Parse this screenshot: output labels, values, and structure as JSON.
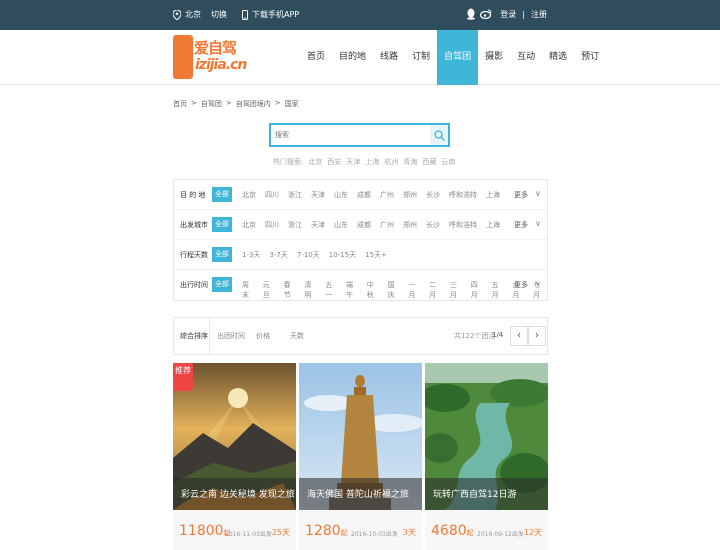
{
  "topbar": {
    "city": "北京",
    "switch": "切换",
    "app": "下载手机APP",
    "login": "登录",
    "sep": "|",
    "register": "注册"
  },
  "logo": {
    "cn": "爱自驾",
    "en": "izijia.cn"
  },
  "nav": [
    {
      "label": "首页",
      "active": false
    },
    {
      "label": "目的地",
      "active": false
    },
    {
      "label": "线路",
      "active": false
    },
    {
      "label": "订制",
      "active": false
    },
    {
      "label": "自驾团",
      "active": true
    },
    {
      "label": "摄影",
      "active": false
    },
    {
      "label": "互动",
      "active": false
    },
    {
      "label": "精选",
      "active": false
    },
    {
      "label": "预订",
      "active": false
    }
  ],
  "breadcrumb": [
    "首页",
    ">",
    "自驾团",
    ">",
    "自驾团境内",
    ">",
    "国家"
  ],
  "search": {
    "placeholder": "搜索"
  },
  "hot": [
    "热门搜索:",
    "北京",
    "西安",
    "天津",
    "上海",
    "杭州",
    "青海",
    "西藏",
    "云南"
  ],
  "filters": [
    {
      "label": "目 的 地",
      "all": "全部",
      "options": [
        "北京",
        "四川",
        "浙江",
        "天津",
        "山东",
        "成都",
        "广州",
        "郑州",
        "长沙",
        "呼和浩特",
        "上海"
      ],
      "more": "更多",
      "chev": "∨"
    },
    {
      "label": "出发城市",
      "all": "全部",
      "options": [
        "北京",
        "四川",
        "浙江",
        "天津",
        "山东",
        "成都",
        "广州",
        "郑州",
        "长沙",
        "呼和浩特",
        "上海"
      ],
      "more": "更多",
      "chev": "∨"
    },
    {
      "label": "行程天数",
      "all": "全部",
      "options": [
        "1-3天",
        "3-7天",
        "7-10天",
        "10-15天",
        "15天+"
      ],
      "more": "",
      "chev": ""
    },
    {
      "label": "出行时间",
      "all": "全部",
      "options": [
        "周末",
        "元旦",
        "春节",
        "清明",
        "五一",
        "端午",
        "中秋",
        "国庆",
        "一月",
        "二月",
        "三月",
        "四月",
        "五月",
        "六月",
        "七月"
      ],
      "more": "更多",
      "chev": "∨"
    }
  ],
  "sort": {
    "default": "综合排序",
    "date": "出团时间",
    "price": "价格",
    "days": "天数",
    "count": "共122个团活",
    "page": "1/4",
    "prev": "‹",
    "next": "›"
  },
  "cards": [
    {
      "title": "彩云之南 边关秘境 发现之旅",
      "price": "11800",
      "unit": "起",
      "date": "2016-11-03出发",
      "days": "25天",
      "ribbon": "推荐"
    },
    {
      "title": "海天佛国 普陀山祈福之旅",
      "price": "1280",
      "unit": "起",
      "date": "2016-10-03出发",
      "days": "3天",
      "ribbon": ""
    },
    {
      "title": "玩转广西自驾12日游",
      "price": "4680",
      "unit": "起",
      "date": "2016-09-12出发",
      "days": "12天",
      "ribbon": ""
    }
  ],
  "colors": {
    "topbar": "#2f4d5c",
    "accent": "#3fb5d8",
    "brand": "#f07a35"
  }
}
